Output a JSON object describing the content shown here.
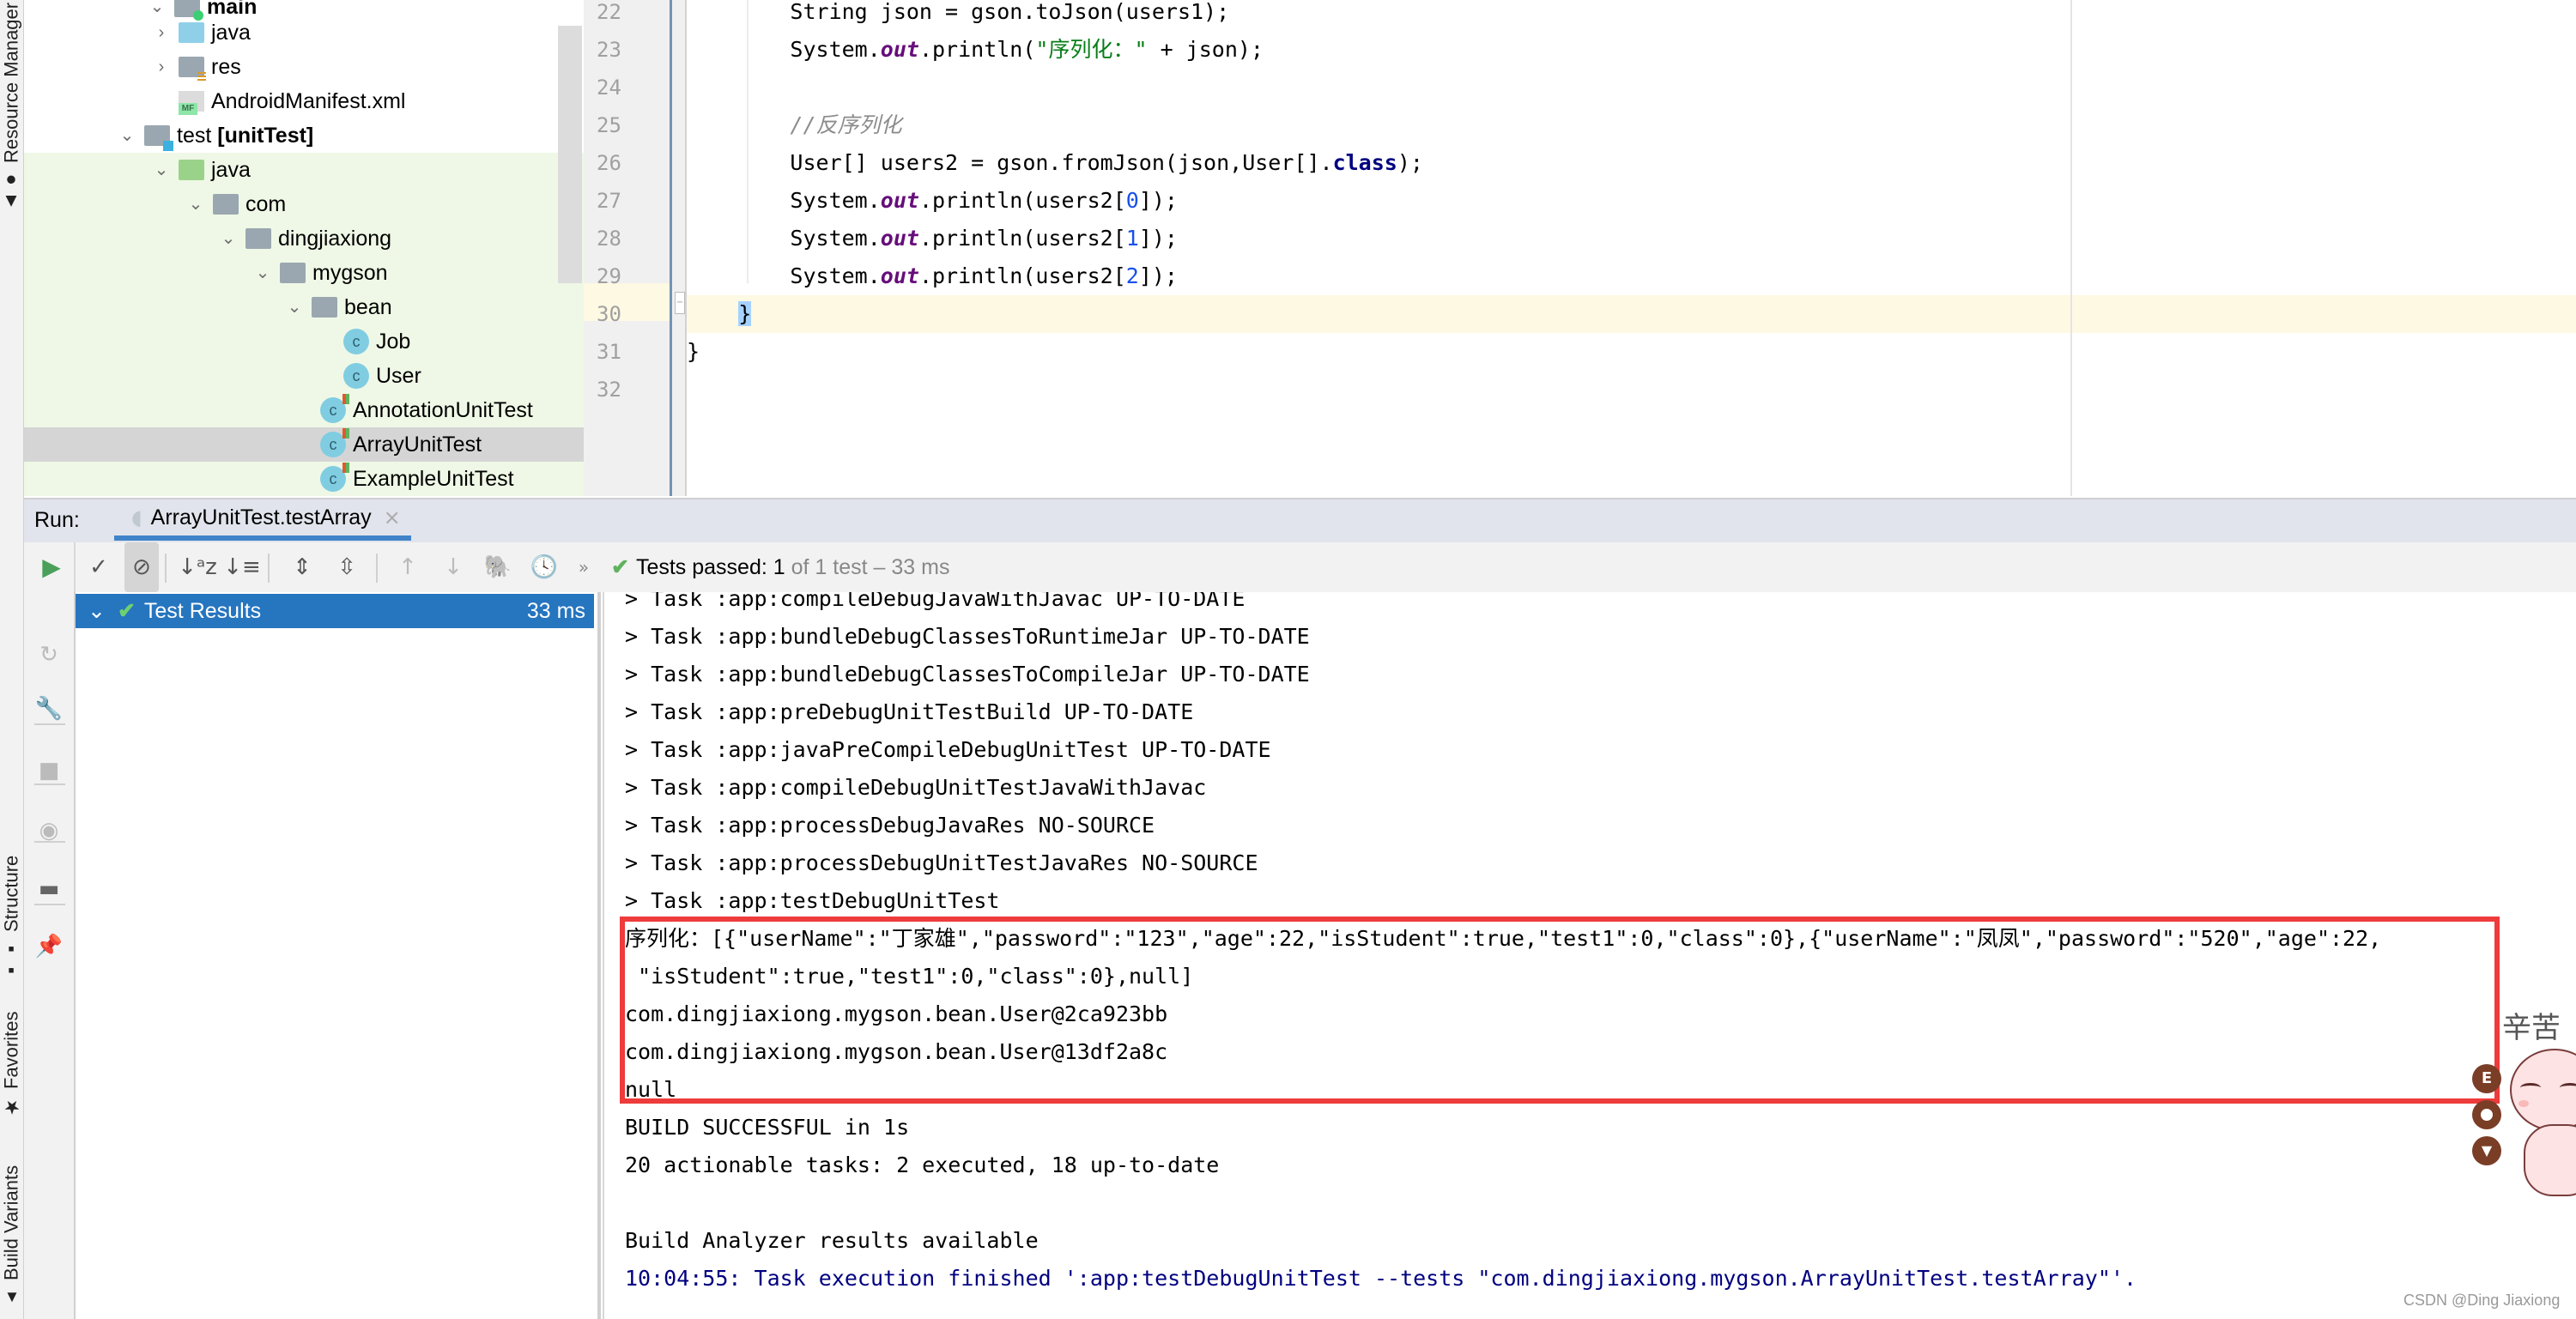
{
  "left_strip": {
    "tabs": [
      {
        "label": "Resource Manager",
        "icon": "resource-manager-icon"
      },
      {
        "label": "Structure",
        "icon": "structure-icon"
      },
      {
        "label": "Favorites",
        "icon": "star-icon"
      },
      {
        "label": "Build Variants",
        "icon": "android-icon"
      }
    ]
  },
  "project_tree": {
    "items": [
      {
        "label": "main",
        "bold": true,
        "expanded": true,
        "icon": "module-folder-icon"
      },
      {
        "label": "java",
        "expanded": false,
        "icon": "source-folder-icon"
      },
      {
        "label": "res",
        "expanded": false,
        "icon": "resource-folder-icon"
      },
      {
        "label": "AndroidManifest.xml",
        "icon": "manifest-file-icon",
        "badge": "MF"
      },
      {
        "label": "test",
        "suffix": "[unitTest]",
        "expanded": true,
        "icon": "test-module-icon"
      },
      {
        "label": "java",
        "expanded": true,
        "icon": "test-source-folder-icon"
      },
      {
        "label": "com",
        "expanded": true,
        "icon": "package-icon"
      },
      {
        "label": "dingjiaxiong",
        "expanded": true,
        "icon": "package-icon"
      },
      {
        "label": "mygson",
        "expanded": true,
        "icon": "package-icon"
      },
      {
        "label": "bean",
        "expanded": true,
        "icon": "package-icon"
      },
      {
        "label": "Job",
        "icon": "class-icon",
        "class_letter": "c"
      },
      {
        "label": "User",
        "icon": "class-icon",
        "class_letter": "c"
      },
      {
        "label": "AnnotationUnitTest",
        "icon": "test-class-icon",
        "class_letter": "c"
      },
      {
        "label": "ArrayUnitTest",
        "icon": "test-class-icon",
        "class_letter": "c",
        "selected": true
      },
      {
        "label": "ExampleUnitTest",
        "icon": "test-class-icon",
        "class_letter": "c"
      }
    ]
  },
  "editor": {
    "lines": [
      {
        "num": "22",
        "segments": [
          {
            "t": "        String json = gson.toJson(users1);",
            "c": ""
          }
        ]
      },
      {
        "num": "23",
        "segments": [
          {
            "t": "        System.",
            "c": ""
          },
          {
            "t": "out",
            "c": "kw-out"
          },
          {
            "t": ".println(",
            "c": ""
          },
          {
            "t": "\"序列化：\"",
            "c": "str"
          },
          {
            "t": " + json);",
            "c": ""
          }
        ]
      },
      {
        "num": "24",
        "segments": [
          {
            "t": "",
            "c": ""
          }
        ]
      },
      {
        "num": "25",
        "segments": [
          {
            "t": "        ",
            "c": ""
          },
          {
            "t": "//反序列化",
            "c": "cmt"
          }
        ]
      },
      {
        "num": "26",
        "segments": [
          {
            "t": "        User[] users2 = gson.fromJson(json,User[].",
            "c": ""
          },
          {
            "t": "class",
            "c": "kw"
          },
          {
            "t": ");",
            "c": ""
          }
        ]
      },
      {
        "num": "27",
        "segments": [
          {
            "t": "        System.",
            "c": ""
          },
          {
            "t": "out",
            "c": "kw-out"
          },
          {
            "t": ".println(users2[",
            "c": ""
          },
          {
            "t": "0",
            "c": "num"
          },
          {
            "t": "]);",
            "c": ""
          }
        ]
      },
      {
        "num": "28",
        "segments": [
          {
            "t": "        System.",
            "c": ""
          },
          {
            "t": "out",
            "c": "kw-out"
          },
          {
            "t": ".println(users2[",
            "c": ""
          },
          {
            "t": "1",
            "c": "num"
          },
          {
            "t": "]);",
            "c": ""
          }
        ]
      },
      {
        "num": "29",
        "segments": [
          {
            "t": "        System.",
            "c": ""
          },
          {
            "t": "out",
            "c": "kw-out"
          },
          {
            "t": ".println(users2[",
            "c": ""
          },
          {
            "t": "2",
            "c": "num"
          },
          {
            "t": "]);",
            "c": ""
          }
        ]
      },
      {
        "num": "30",
        "segments": [
          {
            "t": "    ",
            "c": ""
          },
          {
            "t": "}",
            "c": "bracehl"
          }
        ],
        "current": true
      },
      {
        "num": "31",
        "segments": [
          {
            "t": "}",
            "c": ""
          }
        ]
      },
      {
        "num": "32",
        "segments": [
          {
            "t": "",
            "c": ""
          }
        ]
      }
    ]
  },
  "run_window": {
    "title": "Run:",
    "tab_label": "ArrayUnitTest.testArray",
    "tab_icon": "gradle-elephant-icon",
    "toolbar": {
      "buttons": [
        {
          "name": "show-passed-button",
          "glyph": "✓"
        },
        {
          "name": "show-ignored-button",
          "glyph": "⊘",
          "active": true
        },
        {
          "name": "sort-alphabetically-button",
          "glyph": "↓ᵃz"
        },
        {
          "name": "sort-by-duration-button",
          "glyph": "↓≡"
        },
        {
          "name": "expand-all-button",
          "glyph": "⇕"
        },
        {
          "name": "collapse-all-button",
          "glyph": "⇳"
        },
        {
          "name": "previous-failed-button",
          "glyph": "↑"
        },
        {
          "name": "next-failed-button",
          "glyph": "↓"
        },
        {
          "name": "import-tests-button",
          "glyph": "🐘"
        },
        {
          "name": "test-history-button",
          "glyph": "🕓"
        },
        {
          "name": "more-button",
          "glyph": "»"
        }
      ],
      "status_prefix": "Tests passed:",
      "status_count": "1",
      "status_suffix": "of 1 test – 33 ms"
    },
    "side_buttons": [
      {
        "name": "rerun-button",
        "glyph": "▶"
      },
      {
        "name": "rerun-failed-button",
        "glyph": "↻"
      },
      {
        "name": "settings-wrench-button",
        "glyph": "🔧"
      },
      {
        "name": "stop-button",
        "glyph": "■"
      },
      {
        "name": "view-button",
        "glyph": "◉"
      },
      {
        "name": "layout-button",
        "glyph": "▬"
      },
      {
        "name": "pin-button",
        "glyph": "📌"
      }
    ],
    "test_results": {
      "label": "Test Results",
      "duration": "33 ms"
    },
    "console_lines": [
      {
        "text": "> Task :app:compileDebugJavaWithJavac UP-TO-DATE",
        "style": ""
      },
      {
        "text": "> Task :app:bundleDebugClassesToRuntimeJar UP-TO-DATE",
        "style": ""
      },
      {
        "text": "> Task :app:bundleDebugClassesToCompileJar UP-TO-DATE",
        "style": ""
      },
      {
        "text": "> Task :app:preDebugUnitTestBuild UP-TO-DATE",
        "style": ""
      },
      {
        "text": "> Task :app:javaPreCompileDebugUnitTest UP-TO-DATE",
        "style": ""
      },
      {
        "text": "> Task :app:compileDebugUnitTestJavaWithJavac",
        "style": ""
      },
      {
        "text": "> Task :app:processDebugJavaRes NO-SOURCE",
        "style": ""
      },
      {
        "text": "> Task :app:processDebugUnitTestJavaRes NO-SOURCE",
        "style": ""
      },
      {
        "text": "> Task :app:testDebugUnitTest",
        "style": ""
      },
      {
        "text": "序列化：[{\"userName\":\"丁家雄\",\"password\":\"123\",\"age\":22,\"isStudent\":true,\"test1\":0,\"class\":0},{\"userName\":\"凤凤\",\"password\":\"520\",\"age\":22,",
        "style": ""
      },
      {
        "text": " \"isStudent\":true,\"test1\":0,\"class\":0},null]",
        "style": ""
      },
      {
        "text": "com.dingjiaxiong.mygson.bean.User@2ca923bb",
        "style": ""
      },
      {
        "text": "com.dingjiaxiong.mygson.bean.User@13df2a8c",
        "style": ""
      },
      {
        "text": "null",
        "style": ""
      },
      {
        "text": "BUILD SUCCESSFUL in 1s",
        "style": ""
      },
      {
        "text": "20 actionable tasks: 2 executed, 18 up-to-date",
        "style": ""
      },
      {
        "text": "",
        "style": ""
      },
      {
        "text": "Build Analyzer results available",
        "style": ""
      },
      {
        "text": "10:04:55: Task execution finished ':app:testDebugUnitTest --tests \"com.dingjiaxiong.mygson.ArrayUnitTest.testArray\"'.",
        "style": "blue"
      }
    ]
  },
  "overlay": {
    "mascot_caption": "辛苦",
    "mascot_badges": [
      "E",
      "",
      ""
    ],
    "watermark": "CSDN @Ding Jiaxiong"
  },
  "colors": {
    "selection_blue": "#2675bf",
    "highlight_red": "#ee3b3b",
    "pass_green": "#5fb35f",
    "run_tab_underline": "#4083c9"
  }
}
